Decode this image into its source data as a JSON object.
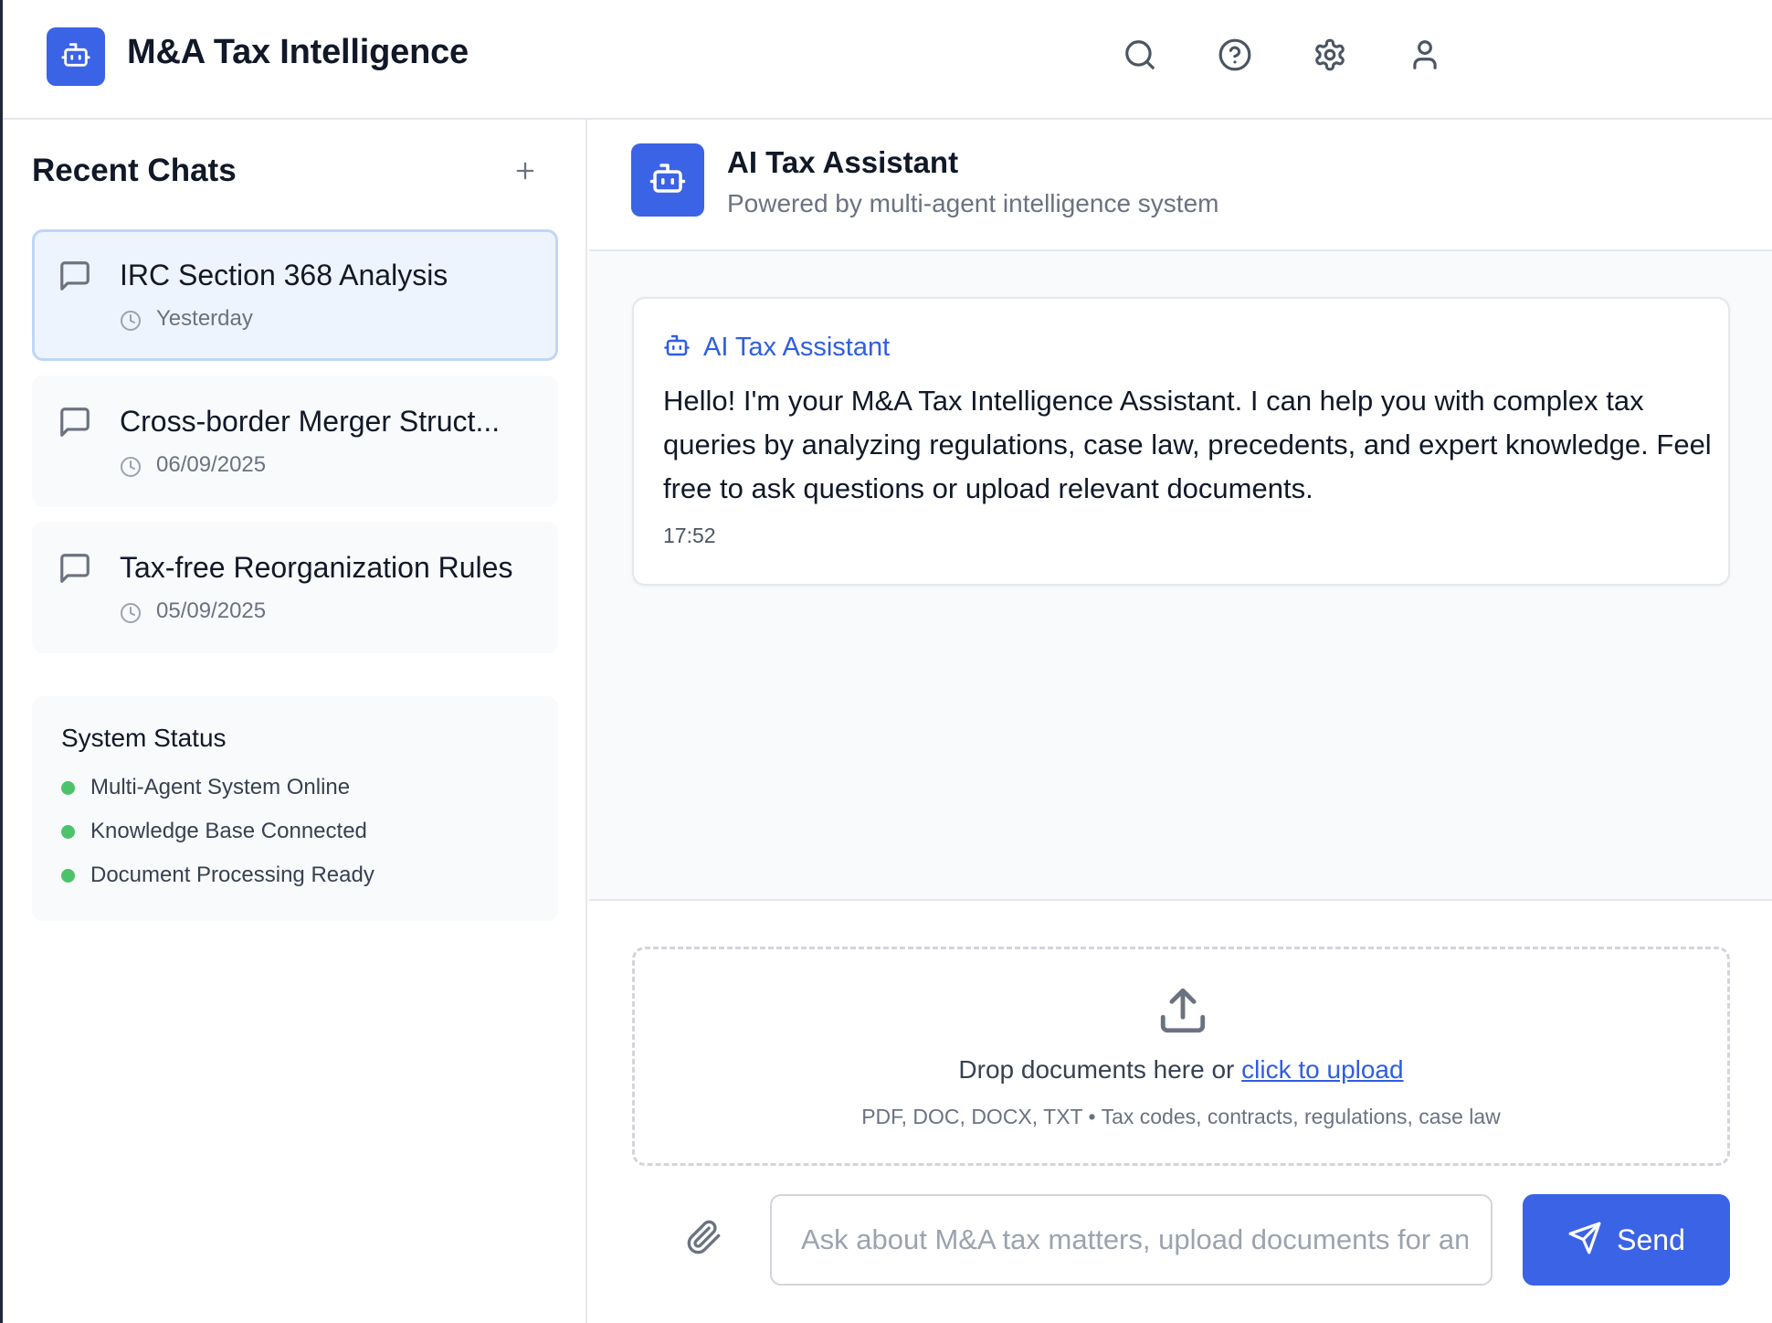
{
  "app": {
    "title": "M&A Tax Intelligence",
    "logo_icon": "robot-icon",
    "accent_color": "#3b63e6"
  },
  "header": {
    "icons": [
      "search-icon",
      "help-circle-icon",
      "gear-icon",
      "user-icon"
    ]
  },
  "sidebar": {
    "title": "Recent Chats",
    "add_icon": "plus-icon",
    "chats": [
      {
        "title": "IRC Section 368 Analysis",
        "date": "Yesterday",
        "active": true
      },
      {
        "title": "Cross-border Merger Struct...",
        "date": "06/09/2025",
        "active": false
      },
      {
        "title": "Tax-free Reorganization Rules",
        "date": "05/09/2025",
        "active": false
      }
    ],
    "status": {
      "title": "System Status",
      "status_color": "#4cc26b",
      "items": [
        "Multi-Agent System Online",
        "Knowledge Base Connected",
        "Document Processing Ready"
      ]
    }
  },
  "chat": {
    "title": "AI Tax Assistant",
    "subtitle": "Powered by multi-agent intelligence system",
    "messages": [
      {
        "sender": "AI Tax Assistant",
        "text": "Hello! I'm your M&A Tax Intelligence Assistant. I can help you with complex tax queries by analyzing regulations, case law, precedents, and expert knowledge. Feel free to ask questions or upload relevant documents.",
        "time": "17:52"
      }
    ]
  },
  "upload": {
    "text": "Drop documents here or ",
    "link": "click to upload",
    "hint": "PDF, DOC, DOCX, TXT • Tax codes, contracts, regulations, case law"
  },
  "composer": {
    "placeholder": "Ask about M&A tax matters, upload documents for analysis...",
    "value": "",
    "send_label": "Send"
  }
}
